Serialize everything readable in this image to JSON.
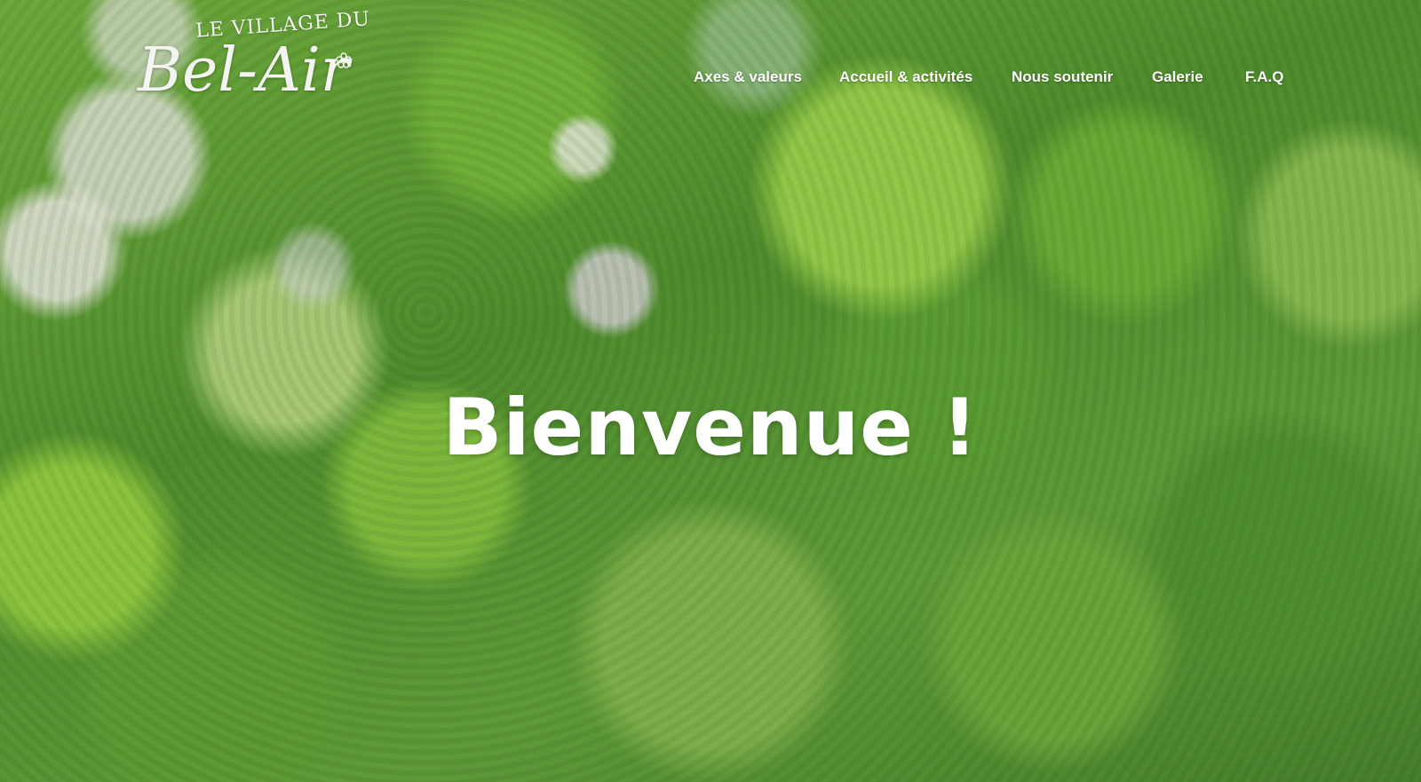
{
  "brand": {
    "name_top": "LE VILLAGE DU",
    "name_main": "Bel-Air"
  },
  "nav": {
    "items": [
      {
        "label": "Axes & valeurs"
      },
      {
        "label": "Accueil & activités"
      },
      {
        "label": "Nous soutenir"
      },
      {
        "label": "Galerie"
      },
      {
        "label": "F.A.Q"
      }
    ]
  },
  "hero": {
    "title": "Bienvenue !",
    "background": "aerial-forest-canopy-image"
  },
  "colors": {
    "nav_text": "#ffffff",
    "title_text": "#ffffff",
    "logo_text": "#f4f4f1",
    "foliage": "#6ea83c"
  }
}
